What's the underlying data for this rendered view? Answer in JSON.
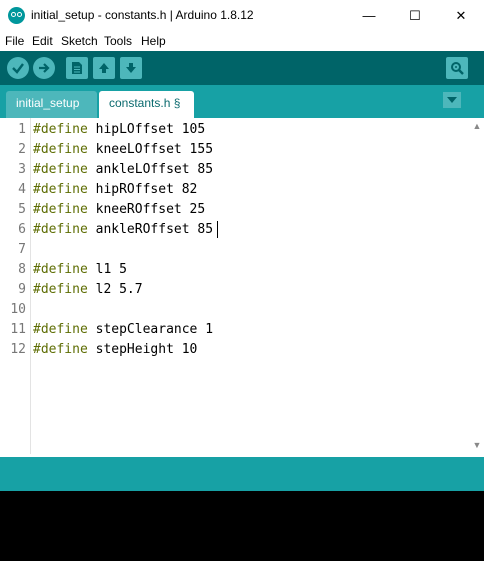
{
  "window": {
    "title": "initial_setup - constants.h | Arduino 1.8.12",
    "minimize": "—",
    "maximize": "☐",
    "close": "✕"
  },
  "menu": [
    "File",
    "Edit",
    "Sketch",
    "Tools",
    "Help"
  ],
  "toolbar": {
    "buttons": [
      "verify-icon",
      "upload-icon",
      "new-icon",
      "open-icon",
      "save-icon",
      "serial-monitor-icon"
    ]
  },
  "tabs": [
    {
      "label": "initial_setup",
      "active": false
    },
    {
      "label": "constants.h §",
      "active": true
    }
  ],
  "code": [
    {
      "n": "1",
      "kw": "#define",
      "rest": " hipLOffset 105"
    },
    {
      "n": "2",
      "kw": "#define",
      "rest": " kneeLOffset 155"
    },
    {
      "n": "3",
      "kw": "#define",
      "rest": " ankleLOffset 85"
    },
    {
      "n": "4",
      "kw": "#define",
      "rest": " hipROffset 82"
    },
    {
      "n": "5",
      "kw": "#define",
      "rest": " kneeROffset 25"
    },
    {
      "n": "6",
      "kw": "#define",
      "rest": " ankleROffset 85"
    },
    {
      "n": "7",
      "kw": "",
      "rest": ""
    },
    {
      "n": "8",
      "kw": "#define",
      "rest": " l1 5"
    },
    {
      "n": "9",
      "kw": "#define",
      "rest": " l2 5.7"
    },
    {
      "n": "10",
      "kw": "",
      "rest": ""
    },
    {
      "n": "11",
      "kw": "#define",
      "rest": " stepClearance 1"
    },
    {
      "n": "12",
      "kw": "#define",
      "rest": " stepHeight 10"
    }
  ],
  "colors": {
    "toolbar": "#006468",
    "tabbar": "#17a1a5",
    "keyword": "#5e6d03",
    "console": "#000000"
  }
}
